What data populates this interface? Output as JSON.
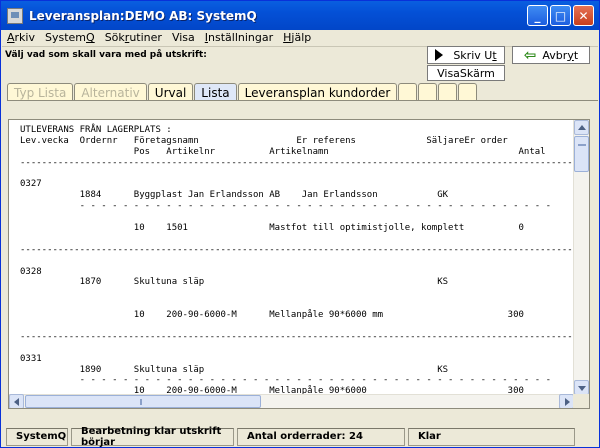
{
  "window": {
    "title": "Leveransplan:DEMO AB: SystemQ",
    "controls": {
      "minimize": "_",
      "maximize": "□",
      "close": "✕"
    }
  },
  "menu": [
    {
      "label": "Arkiv",
      "mnemonic": "A",
      "rest": "rkiv",
      "pre": ""
    },
    {
      "label": "SystemQ",
      "pre": "System",
      "mnemonic": "Q",
      "rest": ""
    },
    {
      "label": "Sökrutiner",
      "pre": "Sök",
      "mnemonic": "r",
      "rest": "utiner"
    },
    {
      "label": "Visa",
      "pre": "",
      "mnemonic": "",
      "rest": "Visa"
    },
    {
      "label": "Inställningar",
      "pre": "",
      "mnemonic": "I",
      "rest": "nställningar"
    },
    {
      "label": "Hjälp",
      "pre": "",
      "mnemonic": "H",
      "rest": "jälp"
    }
  ],
  "prompt": "Välj vad som skall vara med på utskrift:",
  "buttons": {
    "print": {
      "pre": "Skriv U",
      "mnemonic": "t",
      "rest": ""
    },
    "abort": {
      "pre": "Avbr",
      "mnemonic": "y",
      "rest": "t"
    },
    "screen": "VisaSkärm"
  },
  "tabs": [
    {
      "label": "Typ Lista",
      "state": "disabled"
    },
    {
      "label": "Alternativ",
      "state": "disabled"
    },
    {
      "label": "Urval",
      "state": "normal"
    },
    {
      "label": "Lista",
      "state": "active"
    },
    {
      "label": "Leveransplan kundorder",
      "state": "normal"
    }
  ],
  "report": {
    "lines": [
      "UTLEVERANS FRÅN LAGERPLATS :",
      "Lev.vecka  Ordernr   Företagsnamn                  Er referens             SäljareEr order",
      "                     Pos   Artikelnr          Artikelnamn                                   Antal",
      "------------------------------------------------------------------------------------------------------",
      "",
      "0327",
      "           1884      Byggplast Jan Erlandsson AB    Jan Erlandsson           GK",
      "           - - - - - - - - - - - - - - - - - - - - - - - - - - - - - - - - - - - - - - - - - - - -",
      "",
      "                     10    1501               Mastfot till optimistjolle, komplett          0",
      "",
      "------------------------------------------------------------------------------------------------------",
      "",
      "0328",
      "           1870      Skultuna släp                                           KS",
      "",
      "",
      "                     10    200-90-6000-M      Mellanpåle 90*6000 mm                       300",
      "",
      "------------------------------------------------------------------------------------------------------",
      "",
      "0331",
      "           1890      Skultuna släp                                           KS",
      "           - - - - - - - - - - - - - - - - - - - - - - - - - - - - - - - - - - - - - - - - - - - -",
      "                     10    200-90-6000-M      Mellanpåle 90*6000                          300"
    ]
  },
  "status": {
    "system": "SystemQ",
    "message": "Bearbetning klar utskrift börjar",
    "rows": "Antal orderrader: 24",
    "state": "Klar"
  }
}
